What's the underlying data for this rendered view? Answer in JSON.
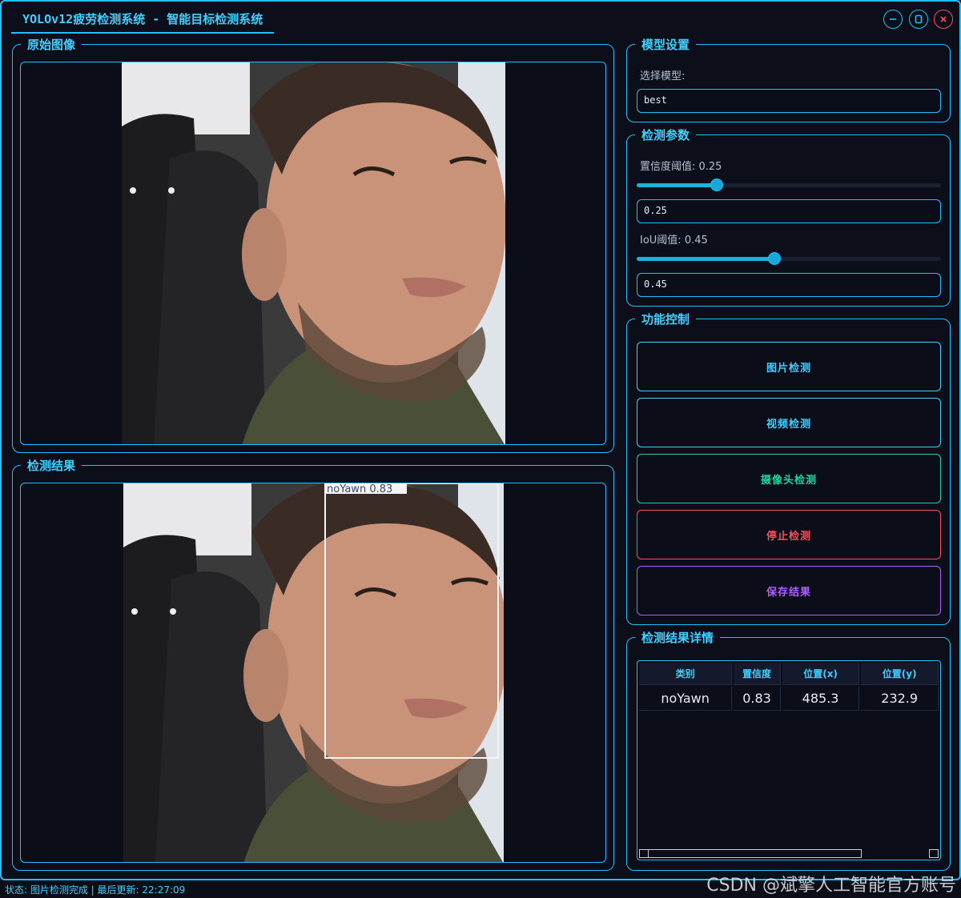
{
  "window": {
    "title": "YOLOv12疲劳检测系统 - 智能目标检测系统",
    "accent_color": "#1ec1ff",
    "background_color": "#0c0f1a",
    "controls": [
      "minimize-icon",
      "maximize-icon",
      "close-icon"
    ]
  },
  "original_panel": {
    "title": "原始图像"
  },
  "result_panel": {
    "title": "检测结果",
    "detection_box_label": "noYawn 0.83"
  },
  "model_settings": {
    "title": "模型设置",
    "select_label": "选择模型:",
    "selected_model": "best"
  },
  "detection_params": {
    "title": "检测参数",
    "confidence_label": "置信度阈值: 0.25",
    "confidence_value": "0.25",
    "confidence_fraction": 0.25,
    "iou_label": "IoU阈值: 0.45",
    "iou_value": "0.45",
    "iou_fraction": 0.45
  },
  "function_control": {
    "title": "功能控制",
    "buttons": [
      {
        "label": "图片检测",
        "color": "#3fd0ff"
      },
      {
        "label": "视频检测",
        "color": "#3fd0ff"
      },
      {
        "label": "摄像头检测",
        "color": "#22d3a0"
      },
      {
        "label": "停止检测",
        "color": "#ff4d5e"
      },
      {
        "label": "保存结果",
        "color": "#b05cff"
      }
    ]
  },
  "results_detail": {
    "title": "检测结果详情",
    "columns": [
      "类别",
      "置信度",
      "位置(x)",
      "位置(y)"
    ],
    "rows": [
      [
        "noYawn",
        "0.83",
        "485.3",
        "232.9"
      ]
    ]
  },
  "status_bar": {
    "text": "状态: 图片检测完成 | 最后更新: 22:27:09"
  },
  "watermark": "CSDN @斌擎人工智能官方账号"
}
